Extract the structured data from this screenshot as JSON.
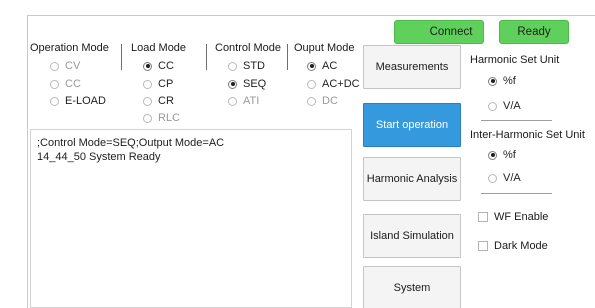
{
  "status": {
    "connect_label": "Connect",
    "ready_label": "Ready",
    "status_color": "#5fd05b"
  },
  "operation_mode": {
    "title": "Operation Mode",
    "options": [
      {
        "label": "CV",
        "state": "disabled"
      },
      {
        "label": "CC",
        "state": "disabled"
      },
      {
        "label": "E-LOAD",
        "state": "enabled"
      }
    ]
  },
  "load_mode": {
    "title": "Load Mode",
    "options": [
      {
        "label": "CC",
        "state": "checked"
      },
      {
        "label": "CP",
        "state": "enabled"
      },
      {
        "label": "CR",
        "state": "enabled"
      },
      {
        "label": "RLC",
        "state": "disabled"
      }
    ]
  },
  "control_mode": {
    "title": "Control  Mode",
    "options": [
      {
        "label": "STD",
        "state": "enabled"
      },
      {
        "label": "SEQ",
        "state": "checked"
      },
      {
        "label": "ATI",
        "state": "disabled"
      }
    ]
  },
  "output_mode": {
    "title": "Ouput Mode",
    "options": [
      {
        "label": "AC",
        "state": "checked"
      },
      {
        "label": "AC+DC",
        "state": "enabled"
      },
      {
        "label": "DC",
        "state": "disabled"
      }
    ]
  },
  "log": {
    "lines": [
      ";Control Mode=SEQ;Output Mode=AC",
      "14_44_50 System Ready"
    ]
  },
  "buttons": {
    "measurements": "Measurements",
    "start_operation": "Start operation",
    "harmonic_analysis": "Harmonic Analysis",
    "island_simulation": "Island Simulation",
    "system": "System"
  },
  "harmonic_set_unit": {
    "title": "Harmonic Set Unit",
    "options": [
      {
        "label": "%f",
        "state": "checked"
      },
      {
        "label": "V/A",
        "state": "enabled"
      }
    ]
  },
  "inter_harmonic_set_unit": {
    "title": "Inter-Harmonic Set Unit",
    "options": [
      {
        "label": "%f",
        "state": "checked"
      },
      {
        "label": "V/A",
        "state": "enabled"
      }
    ]
  },
  "checkboxes": {
    "wf_enable": "WF Enable",
    "dark_mode": "Dark Mode"
  },
  "colors": {
    "active_button": "#3599dd",
    "button_bg": "#f4f4f4"
  }
}
